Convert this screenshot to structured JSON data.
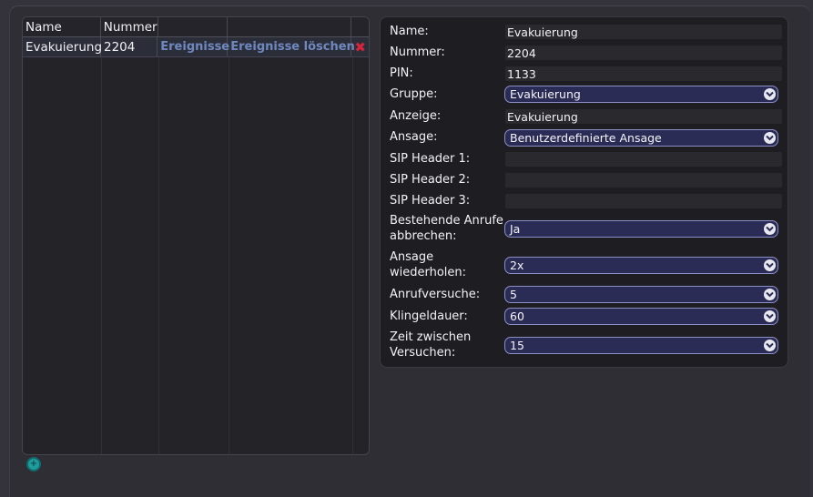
{
  "table": {
    "headers": [
      "Name",
      "Nummer",
      "",
      ""
    ],
    "rows": [
      {
        "name": "Evakuierung",
        "nummer": "2204",
        "events_link": "Ereignisse",
        "delete_events_link": "Ereignisse löschen",
        "delete_icon": "✖"
      }
    ]
  },
  "add_button": {
    "icon": "plus-circle-icon",
    "glyph": "+"
  },
  "form": {
    "name": {
      "label": "Name:",
      "value": "Evakuierung"
    },
    "nummer": {
      "label": "Nummer:",
      "value": "2204"
    },
    "pin": {
      "label": "PIN:",
      "value": "1133"
    },
    "gruppe": {
      "label": "Gruppe:",
      "value": "Evakuierung"
    },
    "anzeige": {
      "label": "Anzeige:",
      "value": "Evakuierung"
    },
    "ansage": {
      "label": "Ansage:",
      "value": "Benutzerdefinierte Ansage"
    },
    "sip1": {
      "label": "SIP Header 1:",
      "value": ""
    },
    "sip2": {
      "label": "SIP Header 2:",
      "value": ""
    },
    "sip3": {
      "label": "SIP Header 3:",
      "value": ""
    },
    "abbrechen": {
      "label_line1": "Bestehende Anrufe",
      "label_line2": "abbrechen:",
      "value": "Ja"
    },
    "wiederholen": {
      "label_line1": "Ansage",
      "label_line2": "wiederholen:",
      "value": "2x"
    },
    "anrufversuche": {
      "label": "Anrufversuche:",
      "value": "5"
    },
    "klingeldauer": {
      "label": "Klingeldauer:",
      "value": "60"
    },
    "zeit": {
      "label_line1": "Zeit zwischen",
      "label_line2": "Versuchen:",
      "value": "15"
    }
  },
  "colors": {
    "link": "#6f89c0",
    "delete": "#d6243a",
    "select_bg": "#2b2c55",
    "select_border": "#8a90c4",
    "add_button": "#1f9c9c"
  }
}
